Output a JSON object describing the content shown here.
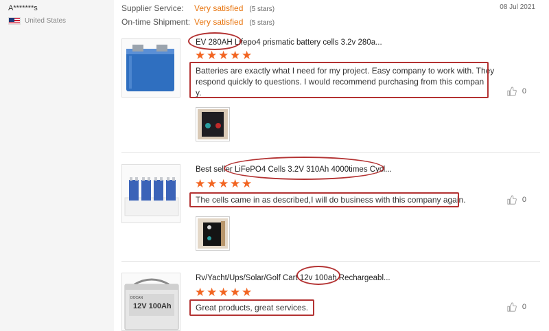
{
  "buyer": {
    "name": "A*******s",
    "country": "United States",
    "flag_icon": "us-flag-icon"
  },
  "ratings": {
    "supplier_service_label": "Supplier Service:",
    "supplier_service_value": "Very satisfied",
    "supplier_service_stars": "(5 stars)",
    "on_time_label": "On-time Shipment:",
    "on_time_value": "Very satisfied",
    "on_time_stars": "(5 stars)"
  },
  "date": "08 Jul 2021",
  "reviews": [
    {
      "product_title": "EV   280AH Lifepo4 prismatic battery cells 3.2v 280a...",
      "stars": 5,
      "text_line1": "Batteries are exactly what I need for my project. Easy company to work with. They",
      "text_line2": "respond quickly  to questions. I would recommend purchasing from this compan",
      "text_line3": "y.",
      "helpful_count": "0"
    },
    {
      "product_title": "Best seller LiFePO4 Cells 3.2V 310Ah 4000times Cycl...",
      "stars": 5,
      "text_line1": "The cells came in as described,I  will do business with this company again.",
      "helpful_count": "0"
    },
    {
      "product_title": "Rv/Yacht/Ups/Solar/Golf Cart 12v 100ah Rechargeabl...",
      "stars": 5,
      "text_line1": "Great products, great services.",
      "helpful_count": "0",
      "product_label": "12V 100Ah",
      "product_brand": "DOCAN"
    }
  ],
  "colors": {
    "accent": "#e8750f",
    "star": "#f26522",
    "annotation": "#b33232"
  }
}
